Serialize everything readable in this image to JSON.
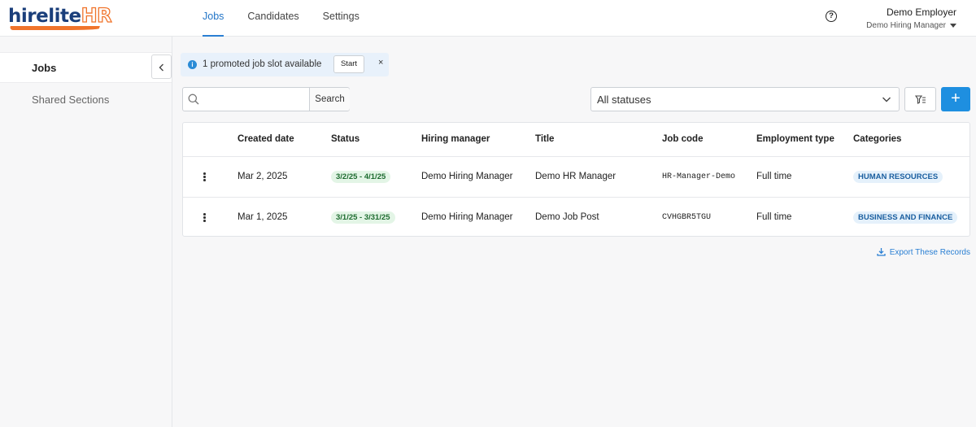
{
  "logo": {
    "part1": "hirelite",
    "part2": "HR"
  },
  "topnav": {
    "tabs": [
      {
        "label": "Jobs",
        "active": true
      },
      {
        "label": "Candidates",
        "active": false
      },
      {
        "label": "Settings",
        "active": false
      }
    ]
  },
  "user": {
    "name": "Demo Employer",
    "role": "Demo Hiring Manager"
  },
  "icons": {
    "help": "question-circle-icon",
    "user_menu": "caret-down-icon"
  },
  "sidebar": {
    "items": [
      {
        "label": "Jobs",
        "active": true
      },
      {
        "label": "Shared Sections",
        "active": false
      }
    ]
  },
  "promo": {
    "text": "1 promoted job slot available",
    "start_label": "Start",
    "close_glyph": "×"
  },
  "search": {
    "placeholder": "",
    "button_label": "Search"
  },
  "status_filter": {
    "selected": "All statuses"
  },
  "add_glyph": "+",
  "table": {
    "headers": [
      "Created date",
      "Status",
      "Hiring manager",
      "Title",
      "Job code",
      "Employment type",
      "Categories"
    ],
    "rows": [
      {
        "created": "Mar 2, 2025",
        "status": "3/2/25 - 4/1/25",
        "manager": "Demo Hiring Manager",
        "title": "Demo HR Manager",
        "code": "HR-Manager-Demo",
        "type": "Full time",
        "category": "HUMAN RESOURCES"
      },
      {
        "created": "Mar 1, 2025",
        "status": "3/1/25 - 3/31/25",
        "manager": "Demo Hiring Manager",
        "title": "Demo Job Post",
        "code": "CVHGBR5TGU",
        "type": "Full time",
        "category": "BUSINESS AND FINANCE"
      }
    ]
  },
  "export": {
    "label": "Export These Records"
  },
  "colors": {
    "accent": "#2a7fd3",
    "primary_button": "#1e8fe0",
    "logo_blue": "#1a3e7a",
    "logo_orange": "#f0742b"
  }
}
